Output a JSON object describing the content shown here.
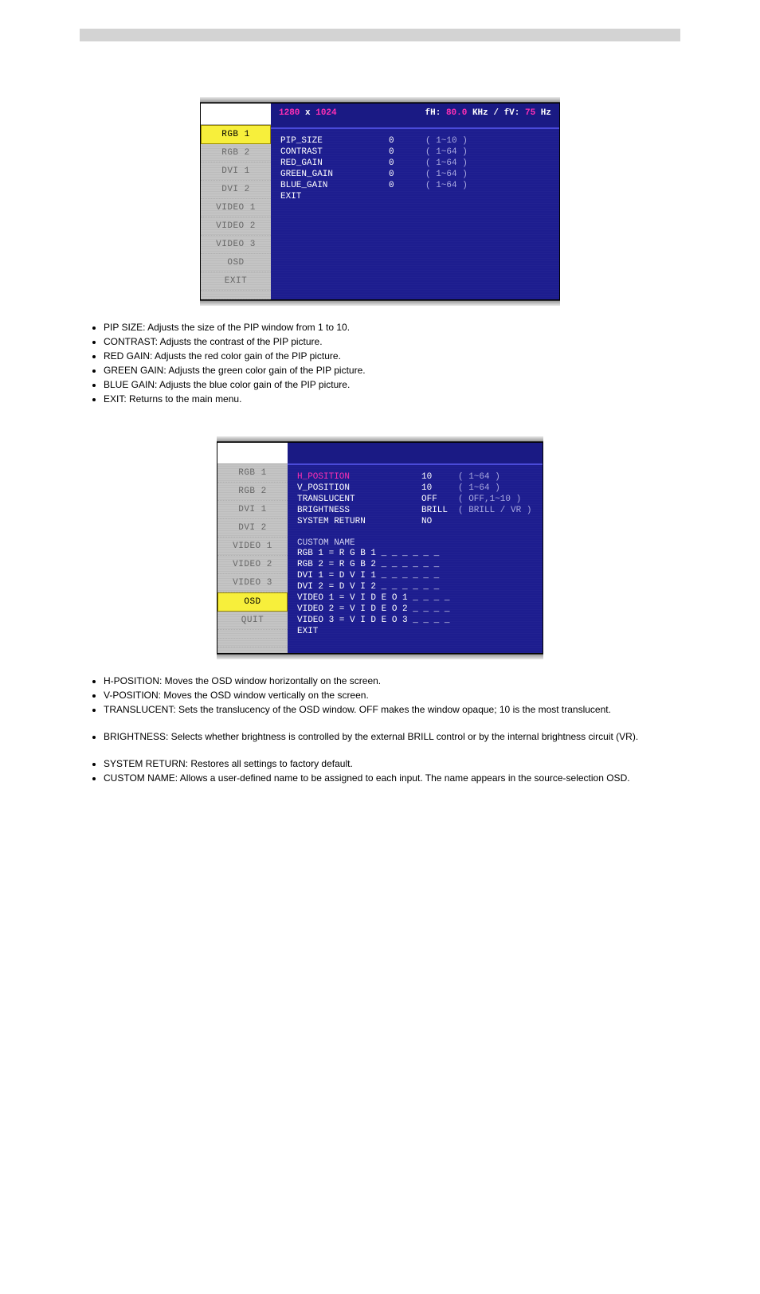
{
  "figure1": {
    "resolution_prefix": "1280",
    "resolution_middle": " x ",
    "resolution_suffix": "1024",
    "rate_label_fh": "fH: ",
    "fh_value": "80.0",
    "rate_unit_khz": " KHz / ",
    "rate_label_fv": "fV: ",
    "fv_value": "75",
    "rate_unit_hz": " Hz",
    "side": {
      "rgb1": "RGB 1",
      "rgb2": "RGB 2",
      "dvi1": "DVI 1",
      "dvi2": "DVI 2",
      "video1": "VIDEO 1",
      "video2": "VIDEO 2",
      "video3": "VIDEO 3",
      "osd": "OSD",
      "exit": "EXIT"
    },
    "rows": {
      "pip_size": {
        "label": "PIP_SIZE",
        "value": "0",
        "range": "( 1~10 )"
      },
      "contrast": {
        "label": "CONTRAST",
        "value": "0",
        "range": "( 1~64 )"
      },
      "red_gain": {
        "label": "RED_GAIN",
        "value": "0",
        "range": "( 1~64 )"
      },
      "green_gain": {
        "label": "GREEN_GAIN",
        "value": "0",
        "range": "( 1~64 )"
      },
      "blue_gain": {
        "label": "BLUE_GAIN",
        "value": "0",
        "range": "( 1~64 )"
      },
      "exit": {
        "label": "EXIT"
      }
    }
  },
  "bullets1": {
    "b1": "PIP SIZE: Adjusts the size of the PIP window from 1 to 10.",
    "b2": "CONTRAST: Adjusts the contrast of the PIP picture.",
    "b3": "RED GAIN: Adjusts the red color gain of the PIP picture.",
    "b4": "GREEN GAIN: Adjusts the green color gain of the PIP picture.",
    "b5": "BLUE GAIN: Adjusts the blue color gain of the PIP picture.",
    "b6": "EXIT: Returns to the main menu."
  },
  "figure2": {
    "side": {
      "rgb1": "RGB 1",
      "rgb2": "RGB 2",
      "dvi1": "DVI 1",
      "dvi2": "DVI 2",
      "video1": "VIDEO 1",
      "video2": "VIDEO 2",
      "video3": "VIDEO 3",
      "osd": "OSD",
      "quit": "QUIT"
    },
    "rows": {
      "h_position": {
        "label": "H_POSITION",
        "value": "10",
        "range": "( 1~64 )"
      },
      "v_position": {
        "label": "V_POSITION",
        "value": "10",
        "range": "( 1~64 )"
      },
      "translucent": {
        "label": "TRANSLUCENT",
        "value": "OFF",
        "range": "( OFF,1~10 )"
      },
      "brightness": {
        "label": "BRIGHTNESS",
        "value": "BRILL",
        "range": "( BRILL / VR )"
      },
      "system_return": {
        "label": "SYSTEM RETURN",
        "value": "NO"
      }
    },
    "custom_name": {
      "title": "CUSTOM NAME",
      "lines": {
        "rgb1": "RGB 1   =  R G B  1 _ _ _ _ _ _",
        "rgb2": "RGB 2   =  R G B  2 _ _ _ _ _ _",
        "dvi1": "DVI 1   =  D V I  1 _ _ _ _ _ _",
        "dvi2": "DVI 2   =  D V I  2 _ _ _ _ _ _",
        "video1": "VIDEO 1 =  V I D E O  1 _ _ _ _",
        "video2": "VIDEO 2 =  V I D E O  2 _ _ _ _",
        "video3": "VIDEO 3 =  V I D E O  3 _ _ _ _"
      },
      "exit": "EXIT"
    }
  },
  "bullets2": {
    "b1": "H-POSITION: Moves the OSD window horizontally on the screen.",
    "b2": "V-POSITION: Moves the OSD window vertically on the screen.",
    "b3": "TRANSLUCENT: Sets the translucency of the OSD window.  OFF makes the window opaque; 10 is the most translucent.",
    "b4": "BRIGHTNESS: Selects whether brightness is controlled by the external BRILL control or by the internal brightness circuit (VR).",
    "b5": "SYSTEM RETURN: Restores all settings to factory default.",
    "b6": "CUSTOM NAME: Allows a user-defined name to be assigned to each input. The name appears in the source-selection OSD."
  }
}
